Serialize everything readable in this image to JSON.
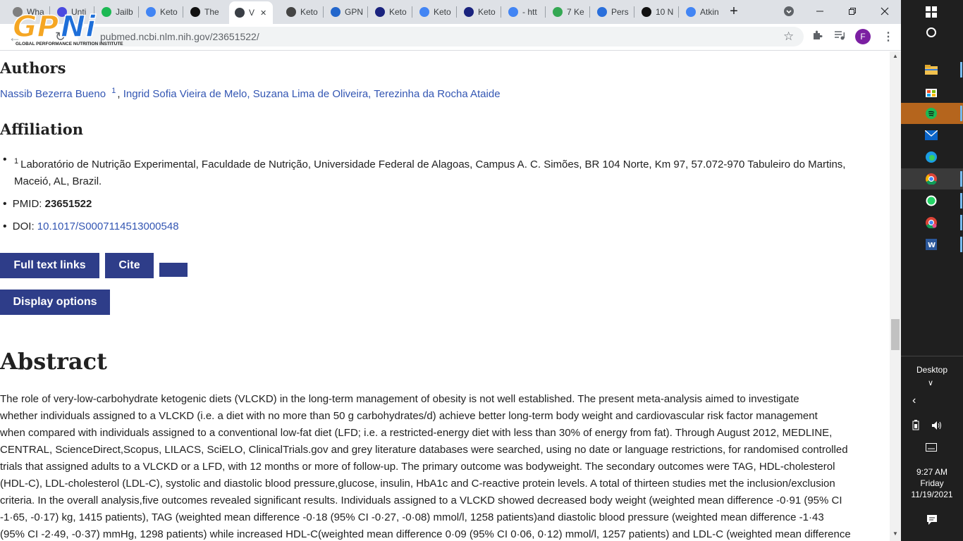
{
  "browser": {
    "tabs": [
      {
        "label": "Wha",
        "color": "#7f7f7f"
      },
      {
        "label": "Unti",
        "color": "#4a4ae0"
      },
      {
        "label": "Jailb",
        "color": "#1db954"
      },
      {
        "label": "Keto",
        "color": "#4285f4"
      },
      {
        "label": "The",
        "color": "#111111"
      },
      {
        "label": "V",
        "color": "#3a3f46"
      },
      {
        "label": "Keto",
        "color": "#444444"
      },
      {
        "label": "GPN",
        "color": "#2266cc"
      },
      {
        "label": "Keto",
        "color": "#1a237e"
      },
      {
        "label": "Keto",
        "color": "#4285f4"
      },
      {
        "label": "Keto",
        "color": "#1a237e"
      },
      {
        "label": "- htt",
        "color": "#4285f4"
      },
      {
        "label": "7 Ke",
        "color": "#34a853"
      },
      {
        "label": "Pers",
        "color": "#2a6fdb"
      },
      {
        "label": "10 N",
        "color": "#111111"
      },
      {
        "label": "Atkin",
        "color": "#4285f4"
      }
    ],
    "new_tab": "+",
    "url": "pubmed.ncbi.nlm.nih.gov/23651522/",
    "profile_initial": "F",
    "profile_color": "#7b1fa2"
  },
  "logo": {
    "mark": "GPNi",
    "subtitle": "GLOBAL PERFORMANCE NUTRITION INSTITUTE"
  },
  "article": {
    "authors_heading": "Authors",
    "authors": [
      {
        "name": "Nassib Bezerra Bueno",
        "sup": "1"
      },
      {
        "name": "Ingrid Sofia Vieira de Melo"
      },
      {
        "name": "Suzana Lima de Oliveira"
      },
      {
        "name": "Terezinha da Rocha Ataide"
      }
    ],
    "affiliation_heading": "Affiliation",
    "affiliation_sup": "1",
    "affiliation_line1": "Laboratório de Nutrição Experimental, Faculdade de Nutrição, Universidade Federal de Alagoas, Campus A. C. Simões, BR 104 Norte, Km 97, 57.072-970 Tabuleiro do Martins,",
    "affiliation_line2": "Maceió, AL, Brazil.",
    "pmid_label": "PMID:",
    "pmid": "23651522",
    "doi_label": "DOI:",
    "doi": "10.1017/S0007114513000548",
    "buttons": {
      "full_text": "Full text links",
      "cite": "Cite",
      "display": "Display options"
    },
    "abstract_heading": "Abstract",
    "abstract_lines": [
      "The role of very-low-carbohydrate ketogenic diets (VLCKD) in the long-term management of obesity is not well established. The present meta-analysis aimed to investigate",
      "whether individuals assigned to a VLCKD (i.e. a diet with no more than 50 g carbohydrates/d) achieve better long-term body weight and cardiovascular risk factor management",
      "when compared with individuals assigned to a conventional low-fat diet (LFD; i.e. a restricted-energy diet with less than 30% of energy from fat). Through August 2012, MEDLINE,",
      "CENTRAL, ScienceDirect,Scopus, LILACS, SciELO, ClinicalTrials.gov and grey literature databases were searched, using no date or language restrictions, for randomised controlled",
      "trials that assigned adults to a VLCKD or a LFD, with 12 months or more of follow-up. The primary outcome was bodyweight. The secondary outcomes were TAG, HDL-cholesterol",
      "(HDL-C), LDL-cholesterol (LDL-C), systolic and diastolic blood pressure,glucose, insulin, HbA1c and C-reactive protein levels. A total of thirteen studies met the inclusion/exclusion",
      "criteria. In the overall analysis,five outcomes revealed significant results. Individuals assigned to a VLCKD showed decreased body weight (weighted mean difference -0·91 (95% CI",
      "-1·65, -0·17) kg, 1415 patients), TAG (weighted mean difference -0·18 (95% CI -0·27, -0·08) mmol/l, 1258 patients)and diastolic blood pressure (weighted mean difference -1·43",
      "(95% CI -2·49, -0·37) mmHg, 1298 patients) while increased HDL-C(weighted mean difference 0·09 (95% CI 0·06, 0·12) mmol/l, 1257 patients) and LDL-C (weighted mean difference"
    ]
  },
  "taskbar": {
    "desktop_label": "Desktop",
    "time": "9:27 AM",
    "day": "Friday",
    "date": "11/19/2021"
  }
}
